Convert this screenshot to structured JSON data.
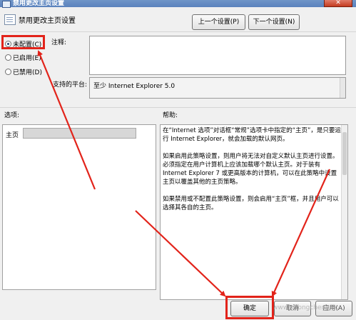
{
  "window": {
    "title": "禁用更改主页设置",
    "close_glyph": "✕"
  },
  "header": {
    "setting_name": "禁用更改主页设置",
    "prev_button": "上一个设置(P)",
    "next_button": "下一个设置(N)"
  },
  "radios": [
    {
      "label": "未配置(C)",
      "selected": true
    },
    {
      "label": "已启用(E)",
      "selected": false
    },
    {
      "label": "已禁用(D)",
      "selected": false
    }
  ],
  "comment": {
    "label": "注释:",
    "value": ""
  },
  "supported": {
    "label": "支持的平台:",
    "value": "至少 Internet Explorer 5.0"
  },
  "options": {
    "label": "选项:",
    "homepage_label": "主页",
    "homepage_value": ""
  },
  "help": {
    "label": "帮助:",
    "paragraphs": [
      "在“Internet 选项”对话框“常规”选项卡中指定的“主页”，是只要运行 Internet Explorer，就会加载的默认网页。",
      "如果启用此策略设置，则用户将无法对自定义默认主页进行设置。必须指定在用户计算机上应该加载哪个默认主页。对于装有 Internet Explorer 7 或更高版本的计算机，可以在此策略中设置主页以覆盖其他的主页策略。",
      "如果禁用或不配置此策略设置，则会启用“主页”框，并且用户可以选择其各自的主页。"
    ]
  },
  "footer": {
    "ok": "确定",
    "cancel": "取消",
    "apply": "应用(A)"
  },
  "annotation_color": "#e2231a",
  "watermark": "www.xitongcheng.cc"
}
